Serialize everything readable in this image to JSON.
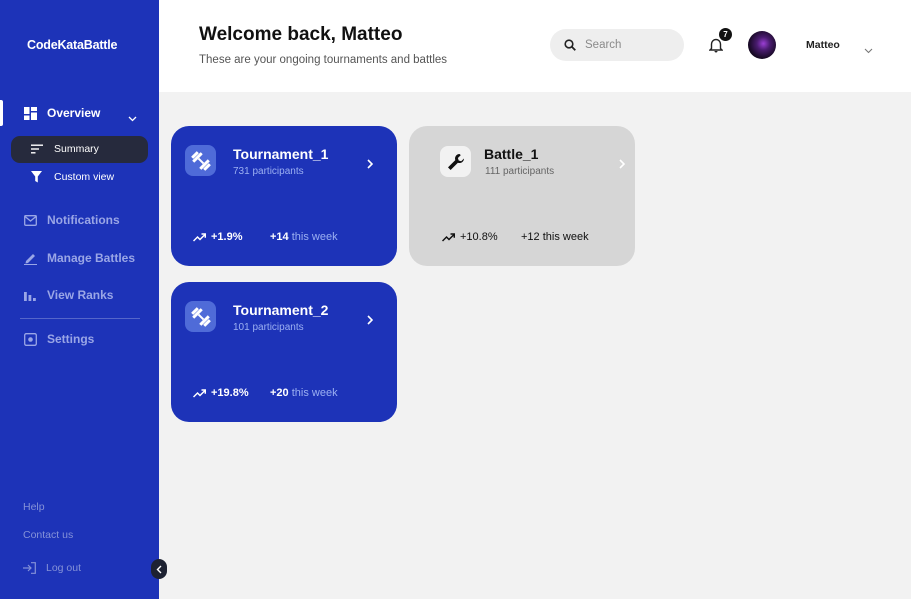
{
  "app": {
    "logo": "CodeKataBattle"
  },
  "sidebar": {
    "overview_label": "Overview",
    "sub_items": [
      {
        "label": "Summary"
      },
      {
        "label": "Custom view"
      }
    ],
    "items": [
      {
        "label": "Notifications"
      },
      {
        "label": "Manage Battles"
      },
      {
        "label": "View Ranks"
      },
      {
        "label": "Settings"
      }
    ],
    "footer": {
      "help": "Help",
      "contact": "Contact us",
      "logout": "Log out"
    }
  },
  "header": {
    "welcome": "Welcome back, Matteo",
    "subtitle": "These are your ongoing tournaments and battles",
    "search_placeholder": "Search",
    "notification_count": "7",
    "username": "Matteo"
  },
  "cards": [
    {
      "title": "Tournament_1",
      "participants": "731 participants",
      "growth": "+1.9%",
      "week_count": "+14",
      "week_label": "this week",
      "type": "tournament",
      "color": "#1d33b8"
    },
    {
      "title": "Battle_1",
      "participants": "111 participants",
      "growth": "+10.8%",
      "week_count": "+12",
      "week_label": "this week",
      "type": "battle",
      "color": "#d6d6d6"
    },
    {
      "title": "Tournament_2",
      "participants": "101 participants",
      "growth": "+19.8%",
      "week_count": "+20",
      "week_label": "this week",
      "type": "tournament",
      "color": "#1d33b8"
    }
  ],
  "colors": {
    "brand": "#1d33b8",
    "background": "#f2f2f2"
  }
}
